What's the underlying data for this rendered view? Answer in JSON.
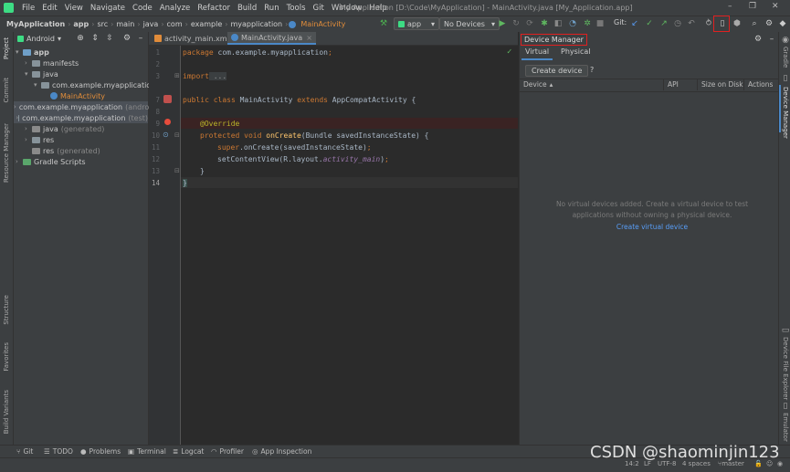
{
  "menu": {
    "items": [
      "File",
      "Edit",
      "View",
      "Navigate",
      "Code",
      "Analyze",
      "Refactor",
      "Build",
      "Run",
      "Tools",
      "Git",
      "Window",
      "Help"
    ],
    "window_title": "My Application [D:\\Code\\MyApplication] - MainActivity.java [My_Application.app]"
  },
  "nav": {
    "crumbs": [
      "MyApplication",
      "app",
      "src",
      "main",
      "java",
      "com",
      "example",
      "myapplication",
      "MainActivity"
    ],
    "run_config": "app",
    "device_selector": "No Devices",
    "git_label": "Git:"
  },
  "left_stripe": {
    "project": "Project",
    "commit": "Commit",
    "resource_manager": "Resource Manager",
    "structure": "Structure",
    "favorites": "Favorites",
    "build_variants": "Build Variants"
  },
  "right_stripe": {
    "gradle": "Gradle",
    "device_manager": "Device Manager",
    "device_file_explorer": "Device File Explorer",
    "emulator": "Emulator"
  },
  "project_panel": {
    "view_mode": "Android",
    "tree": [
      {
        "label": "app",
        "indent": 0
      },
      {
        "label": "manifests",
        "indent": 1
      },
      {
        "label": "java",
        "indent": 1
      },
      {
        "label": "com.example.myapplication",
        "indent": 2
      },
      {
        "label": "MainActivity",
        "indent": 3
      },
      {
        "label": "com.example.myapplication",
        "suffix": "(androidTest)",
        "indent": 2
      },
      {
        "label": "com.example.myapplication",
        "suffix": "(test)",
        "indent": 2
      },
      {
        "label": "java",
        "suffix": "(generated)",
        "indent": 1
      },
      {
        "label": "res",
        "indent": 1
      },
      {
        "label": "res",
        "suffix": "(generated)",
        "indent": 1
      },
      {
        "label": "Gradle Scripts",
        "indent": 0
      }
    ]
  },
  "editor": {
    "tabs": [
      {
        "label": "activity_main.xml"
      },
      {
        "label": "MainActivity.java",
        "active": true
      }
    ],
    "line_numbers": [
      "1",
      "2",
      "3",
      "7",
      "8",
      "9",
      "10",
      "11",
      "12",
      "13",
      "14"
    ],
    "code": {
      "l1_kw": "package",
      "l1_rest": " com.example.myapplication",
      "l3_kw": "import",
      "l3_rest": " ...",
      "l7_kw1": "public class",
      "l7_mid": " MainActivity ",
      "l7_kw2": "extends",
      "l7_rest": " AppCompatActivity {",
      "l9": "@Override",
      "l10_kw": "protected void",
      "l10_fn": " onCreate",
      "l10_rest": "(Bundle savedInstanceState) {",
      "l11_kw": "super",
      "l11_rest": ".onCreate(savedInstanceState)",
      "l12_a": "setContentView(R.layout.",
      "l12_it": "activity_main",
      "l12_b": ")",
      "l13": "}",
      "l14": "}",
      "semi": ";"
    }
  },
  "device_manager": {
    "title": "Device Manager",
    "tabs": [
      "Virtual",
      "Physical"
    ],
    "create_button": "Create device",
    "help": "?",
    "columns": [
      "Device",
      "API",
      "Size on Disk",
      "Actions"
    ],
    "empty_line1": "No virtual devices added. Create a virtual device to test",
    "empty_line2": "applications without owning a physical device.",
    "empty_link": "Create virtual device"
  },
  "bottom_tools": [
    "Git",
    "TODO",
    "Problems",
    "Terminal",
    "Logcat",
    "Profiler",
    "App Inspection"
  ],
  "status": {
    "position": "14:2",
    "line_sep": "LF",
    "encoding": "UTF-8",
    "indent": "4 spaces",
    "branch": "master"
  },
  "watermark": "CSDN @shaominjin123",
  "colors": {
    "accent": "#4a88c7",
    "highlight": "#e02020",
    "android": "#3ddc84"
  }
}
